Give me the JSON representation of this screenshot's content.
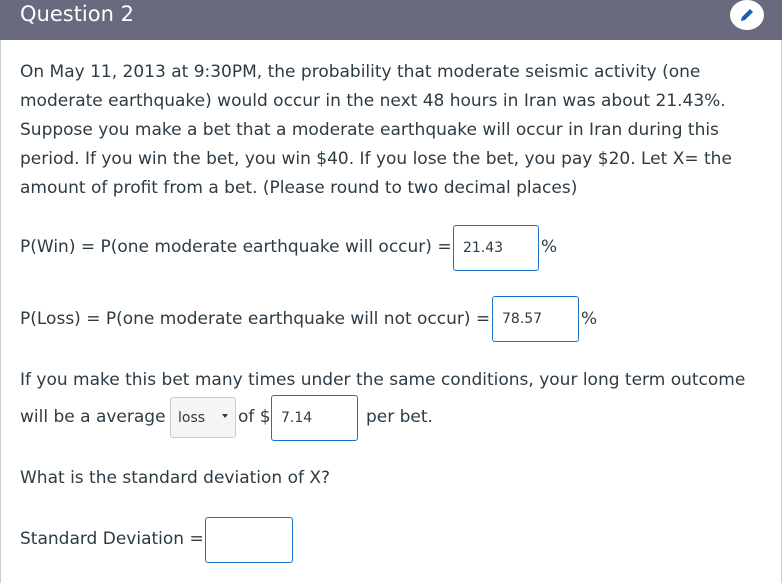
{
  "header": {
    "title": "Question 2",
    "edit_icon": "pencil-icon"
  },
  "question": {
    "paragraph_lines": [
      "On May 11, 2013 at 9:30PM, the probability that moderate seismic activity (one",
      "moderate earthquake) would occur in the next 48 hours in Iran was about 21.43%.",
      "Suppose you make a bet that a moderate earthquake will occur in Iran during this",
      "period. If you win the bet, you win $40. If you lose the bet, you pay $20. Let X= the",
      "amount of profit from a bet. (Please round to two decimal places)"
    ],
    "p_win": {
      "label": "P(Win)  = P(one moderate earthquake will occur)  =",
      "value": "21.43",
      "suffix": "%"
    },
    "p_loss": {
      "label": "P(Loss)  = P(one moderate earthquake will not occur)  =",
      "value": "78.57",
      "suffix": "%"
    },
    "outcome": {
      "line1": "If you make this bet many times under the same conditions, your long term outcome",
      "prefix": "will be a average",
      "select_value": "loss",
      "of_label": "of $",
      "amount": "7.14",
      "suffix": "per bet."
    },
    "sd_question": "What is the standard deviation of X?",
    "sd": {
      "label": "Standard Deviation =",
      "value": ""
    }
  },
  "colors": {
    "header_bg": "#696a7e",
    "input_border": "#1a73c8",
    "text": "#2d3b45",
    "edit_icon": "#1c5fb8"
  }
}
